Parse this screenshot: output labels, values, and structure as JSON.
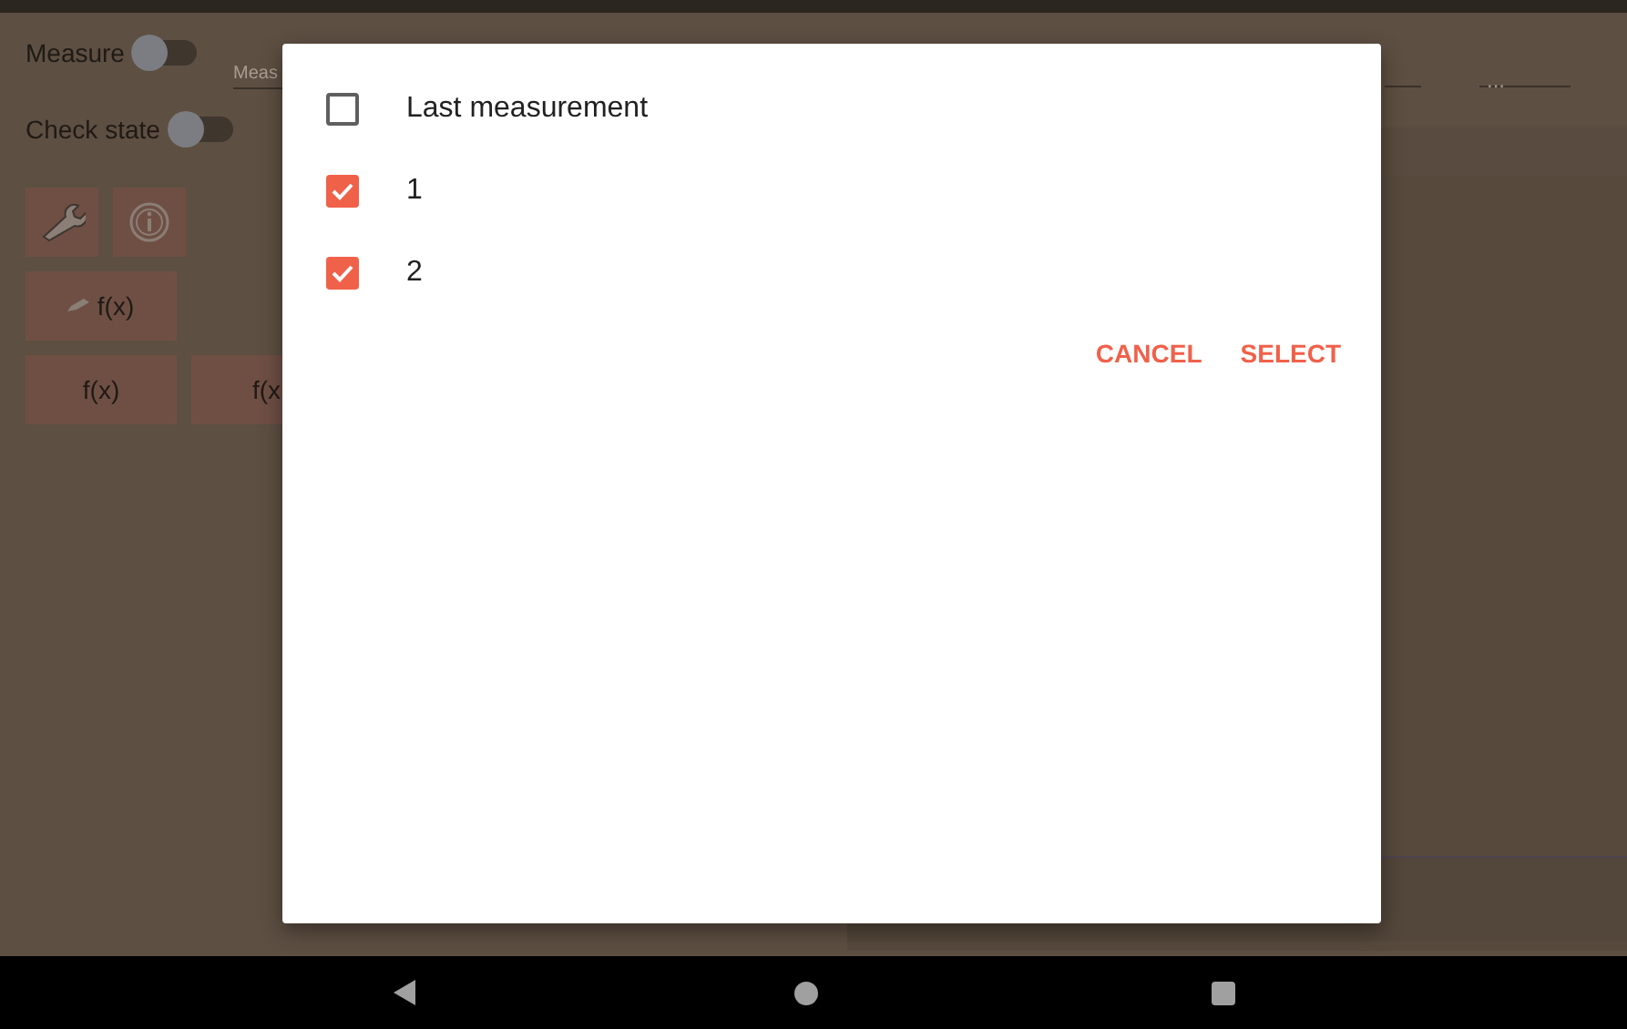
{
  "background": {
    "toggles": [
      {
        "label": "Measure",
        "on": false
      },
      {
        "label": "Check state",
        "on": false
      }
    ],
    "measure_field": {
      "value": "Meas"
    },
    "formula_buttons": [
      {
        "label": "f(x)",
        "kind": "edit"
      },
      {
        "label": "f(x)",
        "kind": "plain"
      },
      {
        "label": "f(x",
        "kind": "plain"
      }
    ],
    "ellipsis": "..."
  },
  "dialog": {
    "items": [
      {
        "label": "Last measurement",
        "checked": false
      },
      {
        "label": "1",
        "checked": true
      },
      {
        "label": "2",
        "checked": true
      }
    ],
    "buttons": [
      "CANCEL",
      "SELECT"
    ]
  }
}
